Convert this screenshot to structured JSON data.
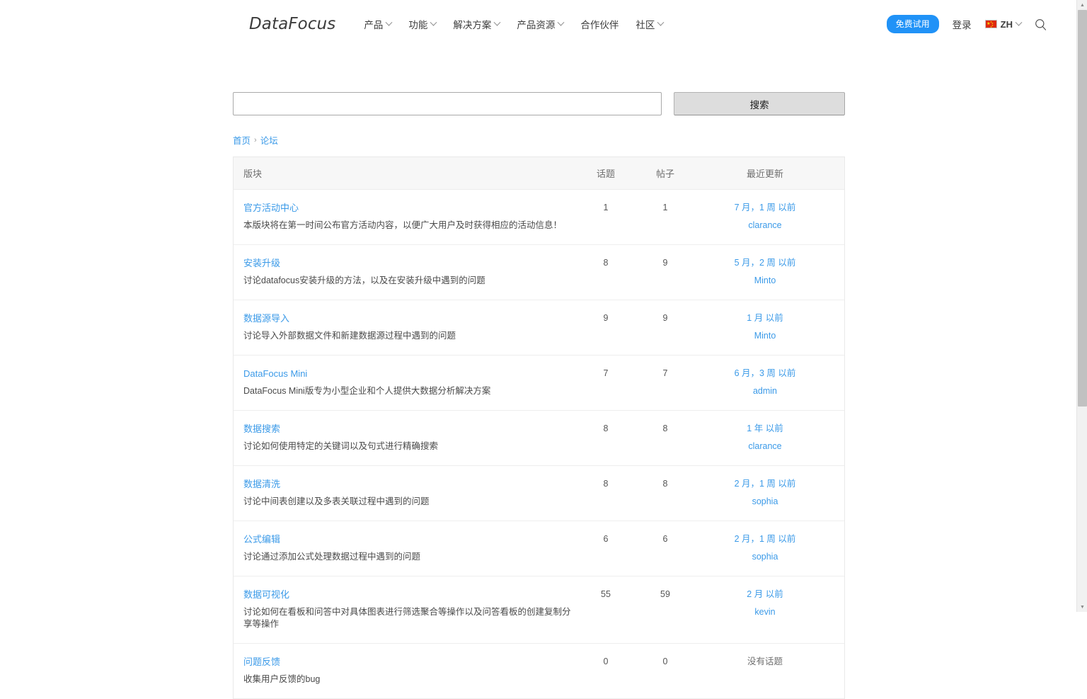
{
  "header": {
    "logo": "DataFocus",
    "nav": [
      {
        "label": "产品",
        "caret": true
      },
      {
        "label": "功能",
        "caret": true
      },
      {
        "label": "解决方案",
        "caret": true
      },
      {
        "label": "产品资源",
        "caret": true
      },
      {
        "label": "合作伙伴",
        "caret": false
      },
      {
        "label": "社区",
        "caret": true
      }
    ],
    "trial_label": "免费试用",
    "login_label": "登录",
    "lang_code": "ZH",
    "trial_color": "#2092f7",
    "link_color": "#3b9ae8"
  },
  "search": {
    "value": "",
    "placeholder": "",
    "button_label": "搜索"
  },
  "breadcrumb": {
    "home": "首页",
    "separator": "›",
    "current": "论坛"
  },
  "table": {
    "columns": {
      "category": "版块",
      "topics": "话题",
      "posts": "帖子",
      "updated": "最近更新"
    },
    "rows": [
      {
        "category": "官方活动中心",
        "description": "本版块将在第一时间公布官方活动内容，以便广大用户及时获得相应的活动信息！",
        "topics": "1",
        "posts": "1",
        "updated_date": "7 月，1 周 以前",
        "updated_user": "clarance",
        "has_topics": true
      },
      {
        "category": "安装升级",
        "description": "讨论datafocus安装升级的方法，以及在安装升级中遇到的问题",
        "topics": "8",
        "posts": "9",
        "updated_date": "5 月，2 周 以前",
        "updated_user": "Minto",
        "has_topics": true
      },
      {
        "category": "数据源导入",
        "description": "讨论导入外部数据文件和新建数据源过程中遇到的问题",
        "topics": "9",
        "posts": "9",
        "updated_date": "1 月 以前",
        "updated_user": "Minto",
        "has_topics": true
      },
      {
        "category": "DataFocus Mini",
        "description": "DataFocus Mini版专为小型企业和个人提供大数据分析解决方案",
        "topics": "7",
        "posts": "7",
        "updated_date": "6 月，3 周 以前",
        "updated_user": "admin",
        "has_topics": true
      },
      {
        "category": "数据搜索",
        "description": "讨论如何使用特定的关键词以及句式进行精确搜索",
        "topics": "8",
        "posts": "8",
        "updated_date": "1 年 以前",
        "updated_user": "clarance",
        "has_topics": true
      },
      {
        "category": "数据清洗",
        "description": "讨论中间表创建以及多表关联过程中遇到的问题",
        "topics": "8",
        "posts": "8",
        "updated_date": "2 月，1 周 以前",
        "updated_user": "sophia",
        "has_topics": true
      },
      {
        "category": "公式编辑",
        "description": "讨论通过添加公式处理数据过程中遇到的问题",
        "topics": "6",
        "posts": "6",
        "updated_date": "2 月，1 周 以前",
        "updated_user": "sophia",
        "has_topics": true
      },
      {
        "category": "数据可视化",
        "description": "讨论如何在看板和问答中对具体图表进行筛选聚合等操作以及问答看板的创建复制分享等操作",
        "topics": "55",
        "posts": "59",
        "updated_date": "2 月 以前",
        "updated_user": "kevin",
        "has_topics": true
      },
      {
        "category": "问题反馈",
        "description": "收集用户反馈的bug",
        "topics": "0",
        "posts": "0",
        "updated_date": "没有话题",
        "updated_user": "",
        "has_topics": false
      }
    ]
  }
}
